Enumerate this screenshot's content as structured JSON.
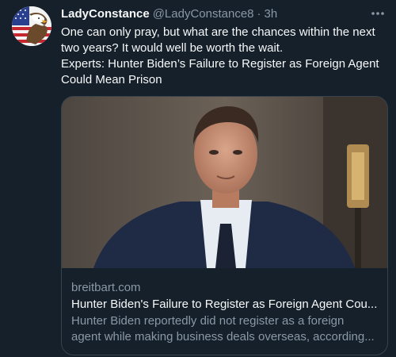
{
  "tweet": {
    "author_name": "LadyConstance",
    "author_handle": "@LadyConstance8",
    "separator": "·",
    "time": "3h",
    "more_icon": "more-horizontal-icon",
    "text_lines": [
      "One can only pray, but what are the chances within the next two years? It would well be worth the wait.",
      "Experts: Hunter Biden’s Failure to Register as Foreign Agent Could Mean Prison"
    ]
  },
  "card": {
    "domain": "breitbart.com",
    "title": "Hunter Biden's Failure to Register as Foreign Agent Cou...",
    "description_lines": [
      "Hunter Biden reportedly did not register as a foreign",
      "agent while making business deals overseas, according..."
    ]
  },
  "colors": {
    "background": "#15202b",
    "primary_text": "#f7f9f9",
    "secondary_text": "#8b98a5",
    "border": "#38444d"
  }
}
